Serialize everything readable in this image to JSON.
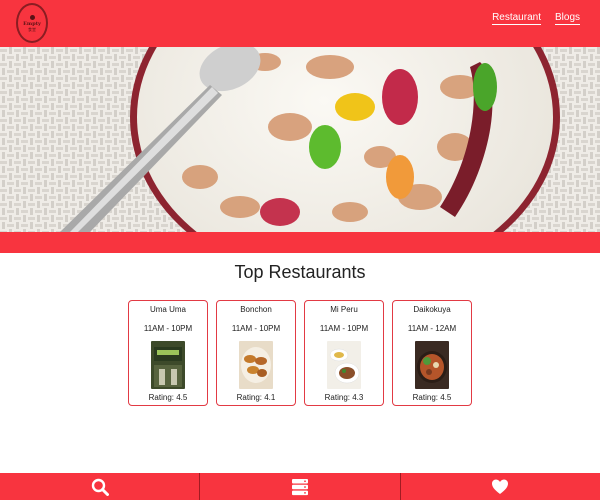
{
  "header": {
    "logo_word": "Empty",
    "logo_sub": "食堂",
    "nav": [
      {
        "label": "Restaurant"
      },
      {
        "label": "Blogs"
      }
    ]
  },
  "main": {
    "section_title": "Top Restaurants",
    "restaurants": [
      {
        "name": "Uma Uma",
        "hours": "11AM - 10PM",
        "rating": "Rating: 4.5"
      },
      {
        "name": "Bonchon",
        "hours": "11AM - 10PM",
        "rating": "Rating: 4.1"
      },
      {
        "name": "Mi Peru",
        "hours": "11AM - 10PM",
        "rating": "Rating: 4.3"
      },
      {
        "name": "Daikokuya",
        "hours": "11AM - 12AM",
        "rating": "Rating: 4.5"
      }
    ]
  },
  "bottom_bar": {
    "icons": [
      "search-icon",
      "server-icon",
      "heart-icon"
    ]
  },
  "colors": {
    "primary_red": "#f8343f",
    "text": "#222222"
  }
}
